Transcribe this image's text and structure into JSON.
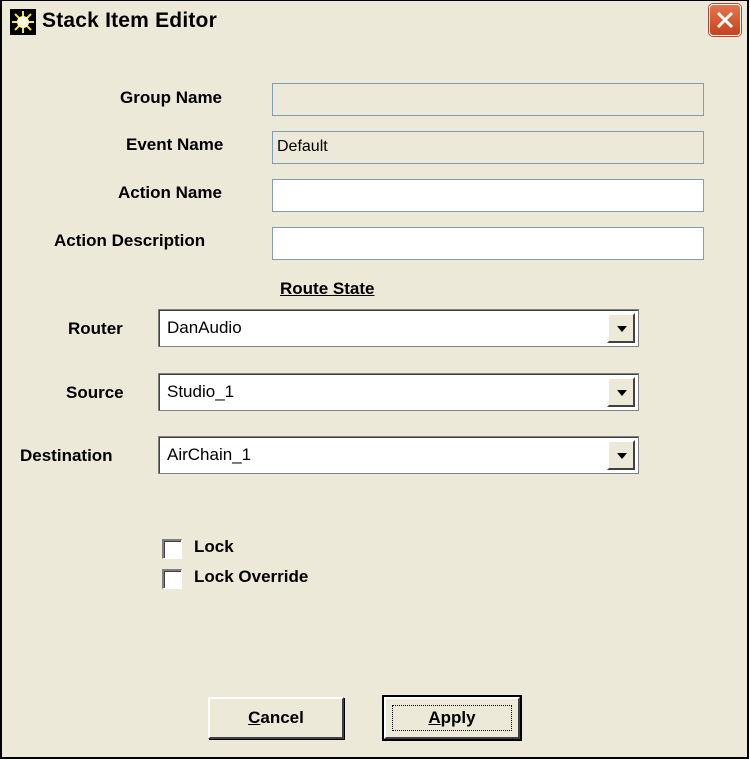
{
  "window": {
    "title": "Stack Item Editor",
    "icon": "sun-burst-icon",
    "close_icon": "close-icon"
  },
  "fields": {
    "group_name": {
      "label": "Group Name",
      "value": ""
    },
    "event_name": {
      "label": "Event Name",
      "value": "Default"
    },
    "action_name": {
      "label": "Action Name",
      "value": ""
    },
    "action_description": {
      "label": "Action Description",
      "value": ""
    }
  },
  "route_state": {
    "heading": "Route State",
    "router": {
      "label": "Router",
      "value": "DanAudio"
    },
    "source": {
      "label": "Source",
      "value": "Studio_1"
    },
    "destination": {
      "label": "Destination",
      "value": "AirChain_1"
    }
  },
  "checkboxes": {
    "lock": {
      "label": "Lock",
      "checked": false
    },
    "lock_override": {
      "label": "Lock Override",
      "checked": false
    }
  },
  "buttons": {
    "cancel": {
      "mnemonic": "C",
      "rest": "ancel"
    },
    "apply": {
      "mnemonic": "A",
      "rest": "pply"
    }
  },
  "colors": {
    "dialog_background": "#ece9d8",
    "close_button": "#d8532b",
    "textbox_border": "#7f9db9"
  }
}
